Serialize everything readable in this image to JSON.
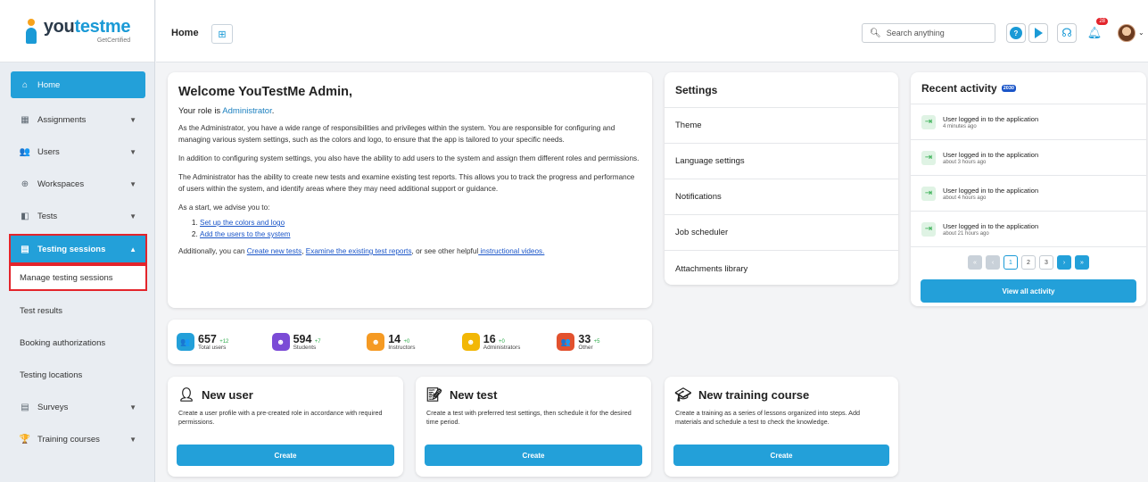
{
  "brand": {
    "name_a": "you",
    "name_b": "testme",
    "tagline": "GetCertified"
  },
  "header": {
    "title": "Home",
    "search_placeholder": "Search anything",
    "notification_count": "28"
  },
  "sidebar": {
    "items": [
      {
        "label": "Home"
      },
      {
        "label": "Assignments"
      },
      {
        "label": "Users"
      },
      {
        "label": "Workspaces"
      },
      {
        "label": "Tests"
      },
      {
        "label": "Testing sessions"
      }
    ],
    "sub_items": [
      {
        "label": "Manage testing sessions"
      },
      {
        "label": "Test results"
      },
      {
        "label": "Booking authorizations"
      },
      {
        "label": "Testing locations"
      }
    ],
    "bottom_items": [
      {
        "label": "Surveys"
      },
      {
        "label": "Training courses"
      }
    ]
  },
  "welcome": {
    "title": "Welcome YouTestMe Admin,",
    "role_prefix": "Your role is ",
    "role": "Administrator",
    "role_suffix": ".",
    "p1": "As the Administrator, you have a wide range of responsibilities and privileges within the system. You are responsible for configuring and managing various system settings, such as the colors and logo, to ensure that the app is tailored to your specific needs.",
    "p2": "In addition to configuring system settings, you also have the ability to add users to the system and assign them different roles and permissions.",
    "p3": "The Administrator has the ability to create new tests and examine existing test reports. This allows you to track the progress and performance of users within the system, and identify areas where they may need additional support or guidance.",
    "p4": "As a start, we advise you to:",
    "step1": "Set up the colors and logo",
    "step2": "Add the users to the system",
    "final_prefix": "Additionally, you can ",
    "link1": "Create new tests",
    "sep1": ", ",
    "link2": "Examine the existing test reports",
    "mid": ", or see other helpful",
    "link3": " instructional videos."
  },
  "stats": [
    {
      "value": "657",
      "delta": "+12",
      "label": "Total users",
      "color": "#23a0d9"
    },
    {
      "value": "594",
      "delta": "+7",
      "label": "Students",
      "color": "#7b4bd6"
    },
    {
      "value": "14",
      "delta": "+0",
      "label": "Instructors",
      "color": "#f59a23"
    },
    {
      "value": "16",
      "delta": "+0",
      "label": "Administrators",
      "color": "#f2b705"
    },
    {
      "value": "33",
      "delta": "+5",
      "label": "Other",
      "color": "#e2512e"
    }
  ],
  "actions": [
    {
      "title": "New user",
      "desc": "Create a user profile with a pre-created role in accordance with required permissions.",
      "button": "Create"
    },
    {
      "title": "New test",
      "desc": "Create a test with preferred test settings, then schedule it for the desired time period.",
      "button": "Create"
    },
    {
      "title": "New training course",
      "desc": "Create a training as a series of lessons organized into steps. Add materials and schedule a test to check the knowledge.",
      "button": "Create"
    }
  ],
  "settings": {
    "title": "Settings",
    "items": [
      "Theme",
      "Language settings",
      "Notifications",
      "Job scheduler",
      "Attachments library"
    ]
  },
  "recent": {
    "title": "Recent activity",
    "count": "2030",
    "items": [
      {
        "text": "User logged in to the application",
        "time": "4 minutes ago"
      },
      {
        "text": "User logged in to the application",
        "time": "about 3 hours ago"
      },
      {
        "text": "User logged in to the application",
        "time": "about 4 hours ago"
      },
      {
        "text": "User logged in to the application",
        "time": "about 21 hours ago"
      }
    ],
    "pages": [
      "1",
      "2",
      "3"
    ],
    "view_all": "View all activity"
  }
}
